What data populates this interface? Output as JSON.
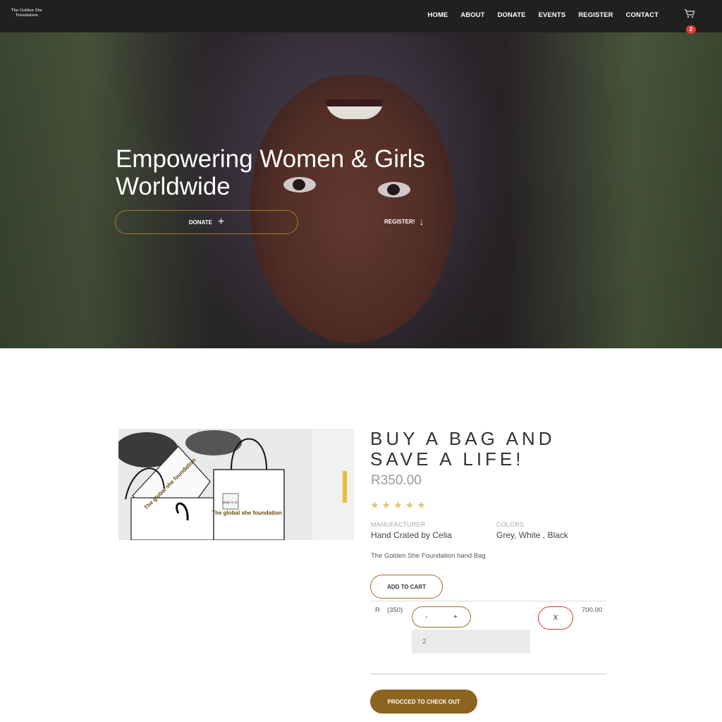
{
  "brand": {
    "line1": "The Golden She",
    "line2": "Foundation"
  },
  "nav": {
    "items": [
      "HOME",
      "ABOUT",
      "DONATE",
      "EVENTS",
      "REGISTER",
      "CONTACT"
    ],
    "cart_count": "2"
  },
  "hero": {
    "title_line1": "Empowering Women & Girls",
    "title_line2": "Worldwide",
    "donate_label": "DONATE",
    "register_label": "REGISTER!"
  },
  "product": {
    "image_text_1": "The global she foundation",
    "image_text_2": "The global she foundation",
    "tag_text": "Made in SA",
    "title_line1": "BUY A BAG AND",
    "title_line2": "SAVE A LIFE!",
    "price": "R350.00",
    "rating": 5,
    "rating_max": 5,
    "manufacturer_label": "MANUFACTURER",
    "manufacturer_value": "Hand Crated by Celia",
    "colors_label": "COLORS",
    "colors_value": "Grey, White , Black",
    "description": "The Golden She Foundation hand Bag",
    "add_to_cart_label": "ADD TO CART"
  },
  "cart_line": {
    "currency": "R",
    "unit_price": "(350)",
    "minus_label": "-",
    "plus_label": "+",
    "quantity": "2",
    "remove_label": "X",
    "line_total": "700.00"
  },
  "checkout_label": "PROCCED TO CHECK OUT",
  "colors": {
    "accent": "#8c6420",
    "nav_bg": "#202020",
    "badge": "#e53935",
    "star": "#e2c479"
  }
}
